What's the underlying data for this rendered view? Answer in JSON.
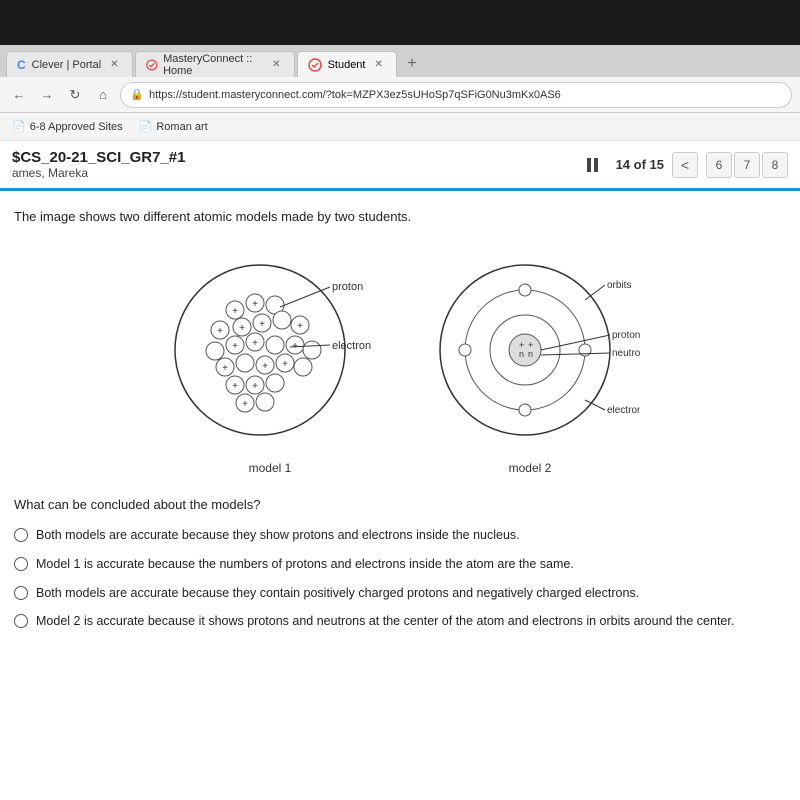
{
  "browser": {
    "tabs": [
      {
        "id": "tab1",
        "label": "Clever | Portal",
        "active": false,
        "icon": "C"
      },
      {
        "id": "tab2",
        "label": "MasteryConnect :: Home",
        "active": false,
        "icon": "M"
      },
      {
        "id": "tab3",
        "label": "Student",
        "active": true,
        "icon": "S"
      }
    ],
    "address": "https://student.masteryconnect.com/?tok=MZPX3ez5sUHoSp7qSFiG0Nu3mKx0AS6",
    "bookmarks": [
      {
        "label": "6-8 Approved Sites"
      },
      {
        "label": "Roman art"
      }
    ]
  },
  "assessment": {
    "title": "$CS_20-21_SCI_GR7_#1",
    "student_name": "ames, Mareka",
    "question_counter": "14 of 15",
    "nav_numbers": [
      "6",
      "7",
      "8"
    ]
  },
  "question": {
    "text": "The image shows two different atomic models made by two students.",
    "models": {
      "model1_label": "model 1",
      "model2_label": "model 2",
      "labels": {
        "proton": "proton",
        "electron": "electron",
        "orbits": "orbits",
        "neutron": "neutron"
      }
    },
    "prompt": "What can be concluded about the models?",
    "choices": [
      {
        "id": "A",
        "text": "Both models are accurate because they show protons and electrons inside the nucleus."
      },
      {
        "id": "B",
        "text": "Model 1 is accurate because the numbers of protons and electrons inside the atom are the same."
      },
      {
        "id": "C",
        "text": "Both models are accurate because they contain positively charged protons and negatively charged electrons."
      },
      {
        "id": "D",
        "text": "Model 2 is accurate because it shows protons and neutrons at the center of the atom and electrons in orbits around the center."
      }
    ]
  },
  "labels": {
    "pause": "||",
    "back_arrow": "<",
    "new_tab": "+"
  }
}
